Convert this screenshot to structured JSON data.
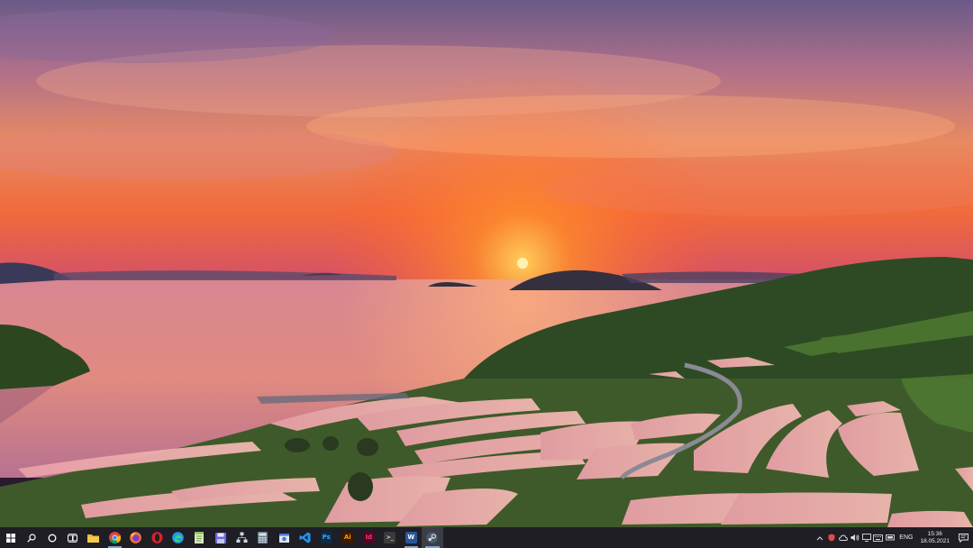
{
  "desktop": {
    "wallpaper_icon": "sunset-rice-terraces-wallpaper"
  },
  "taskbar": {
    "start_icon": "windows-logo-icon",
    "search_icon": "search-icon",
    "cortana_icon": "cortana-circle-icon",
    "taskview_icon": "task-view-icon",
    "apps": [
      {
        "name": "file-explorer",
        "icon": "folder-icon",
        "color": "#e8b73a",
        "glyph": ""
      },
      {
        "name": "chrome",
        "icon": "chrome-icon",
        "color": "#4caf50",
        "glyph": ""
      },
      {
        "name": "firefox",
        "icon": "firefox-icon",
        "color": "#ff7139",
        "glyph": ""
      },
      {
        "name": "opera",
        "icon": "opera-icon",
        "color": "#e0202c",
        "glyph": ""
      },
      {
        "name": "edge",
        "icon": "edge-icon",
        "color": "#1f9ee0",
        "glyph": ""
      },
      {
        "name": "notepad-plus",
        "icon": "notepad-icon",
        "color": "#8bc34a",
        "glyph": ""
      },
      {
        "name": "save-app",
        "icon": "floppy-icon",
        "color": "#6a6adf",
        "glyph": ""
      },
      {
        "name": "network-app",
        "icon": "network-icon",
        "color": "#8aa0b8",
        "glyph": ""
      },
      {
        "name": "calculator",
        "icon": "calculator-icon",
        "color": "#7c8d9a",
        "glyph": ""
      },
      {
        "name": "installer",
        "icon": "installer-icon",
        "color": "#4a7bd0",
        "glyph": ""
      },
      {
        "name": "vscode",
        "icon": "vscode-icon",
        "color": "#2196f3",
        "glyph": ""
      },
      {
        "name": "photoshop",
        "icon": "photoshop-icon",
        "color": "#0e2a44",
        "glyph": "Ps"
      },
      {
        "name": "illustrator",
        "icon": "illustrator-icon",
        "color": "#3b1a00",
        "glyph": "Ai"
      },
      {
        "name": "indesign",
        "icon": "indesign-icon",
        "color": "#4a0a26",
        "glyph": "Id"
      },
      {
        "name": "terminal",
        "icon": "terminal-icon",
        "color": "#3a3a3a",
        "glyph": ">_"
      },
      {
        "name": "word",
        "icon": "word-icon",
        "color": "#2b579a",
        "glyph": "W"
      },
      {
        "name": "steam",
        "icon": "steam-icon",
        "color": "#4a5a6a",
        "glyph": ""
      }
    ],
    "tray": {
      "chevron_icon": "chevron-up-icon",
      "icons": [
        "shield-icon",
        "cloud-icon",
        "volume-icon",
        "network-icon",
        "keyboard-icon",
        "monitor-icon"
      ],
      "language": "ENG",
      "time": "15:36",
      "date": "18.05.2021",
      "notification_icon": "notification-icon"
    }
  }
}
